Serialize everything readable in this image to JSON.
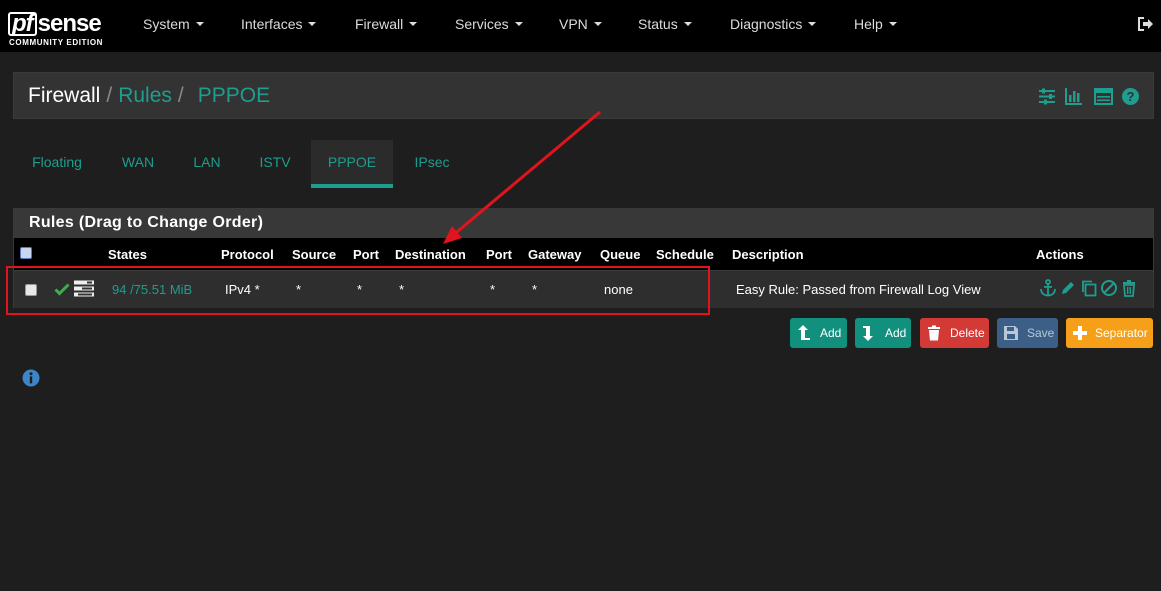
{
  "brand": {
    "logo_main": "sense",
    "logo_pf": "pf",
    "logo_sub": "COMMUNITY EDITION"
  },
  "nav": {
    "items": [
      {
        "label": "System"
      },
      {
        "label": "Interfaces"
      },
      {
        "label": "Firewall"
      },
      {
        "label": "Services"
      },
      {
        "label": "VPN"
      },
      {
        "label": "Status"
      },
      {
        "label": "Diagnostics"
      },
      {
        "label": "Help"
      }
    ],
    "logout_icon": "sign-out-icon"
  },
  "breadcrumb": {
    "root": "Firewall",
    "level1": "Rules",
    "level2": "PPPOE",
    "separator": "/",
    "icons": [
      "sliders-icon",
      "bar-chart-icon",
      "table-icon",
      "question-circle-icon"
    ]
  },
  "tabs": [
    {
      "label": "Floating"
    },
    {
      "label": "WAN"
    },
    {
      "label": "LAN"
    },
    {
      "label": "ISTV"
    },
    {
      "label": "PPPOE",
      "active": true
    },
    {
      "label": "IPsec"
    }
  ],
  "rules": {
    "heading": "Rules (Drag to Change Order)",
    "columns": [
      "States",
      "Protocol",
      "Source",
      "Port",
      "Destination",
      "Port",
      "Gateway",
      "Queue",
      "Schedule",
      "Description",
      "Actions"
    ],
    "rows": [
      {
        "status_icon": "check-icon",
        "log_icon": "tasks-icon",
        "states": "94 /75.51 MiB",
        "protocol": "IPv4 *",
        "source": "*",
        "source_port": "*",
        "destination": "*",
        "destination_port": "*",
        "gateway": "*",
        "queue": "none",
        "schedule": "",
        "description": "Easy Rule: Passed from Firewall Log View",
        "action_icons": [
          "anchor-icon",
          "pencil-icon",
          "copy-icon",
          "ban-icon",
          "trash-icon"
        ]
      }
    ]
  },
  "buttons": {
    "add_top": "Add",
    "add_bottom": "Add",
    "delete": "Delete",
    "save": "Save",
    "separator": "Separator"
  },
  "colors": {
    "accent": "#1d9e8e",
    "delete": "#d43a35",
    "save": "#3b5f87",
    "separator": "#f6a01a",
    "annotation": "#e0141c"
  }
}
